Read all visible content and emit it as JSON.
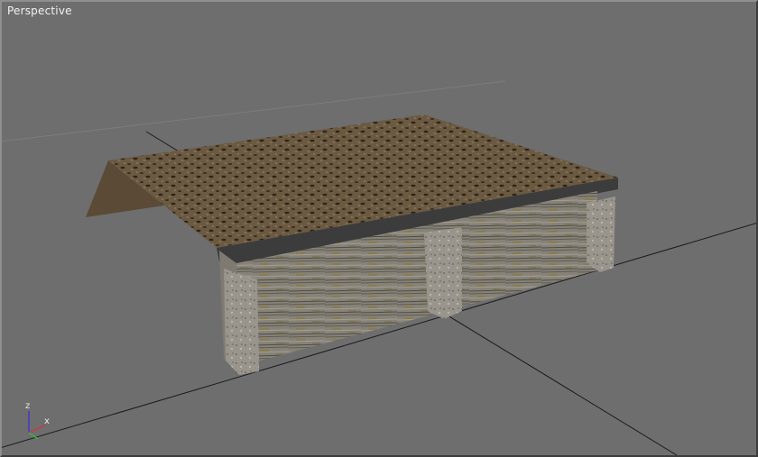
{
  "viewport": {
    "label": "Perspective",
    "background": "#6e6e6e",
    "border_color": "#8f8f8f"
  },
  "axis_gizmo": {
    "z_label": "z",
    "x_label": "x",
    "colors": {
      "x": "#c83c3c",
      "y": "#3cb43c",
      "z": "#3c3cc8"
    }
  },
  "model": {
    "roof_color": "#6b5a42",
    "wall_color": "#8d8a80",
    "post_color": "#9a958c"
  }
}
